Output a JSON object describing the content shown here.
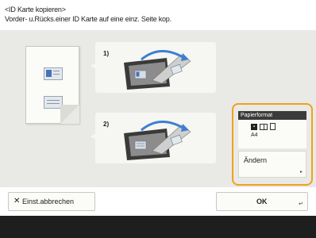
{
  "header": {
    "title": "<ID Karte kopieren>",
    "subtitle": "Vorder- u.Rücks.einer ID Karte auf eine einz. Seite kop."
  },
  "steps": [
    {
      "label": "1)"
    },
    {
      "label": "2)"
    }
  ],
  "paper_format": {
    "title": "Papierformat",
    "size": "A4",
    "change_label": "Ändern",
    "icons": [
      "duplex-icon",
      "book-icon",
      "page-icon"
    ]
  },
  "buttons": {
    "cancel_label": "Einst.abbrechen",
    "ok_label": "OK"
  },
  "colors": {
    "accent": "#f0a21c",
    "panel": "#e9e9e6",
    "photo": "#4a72b8"
  }
}
